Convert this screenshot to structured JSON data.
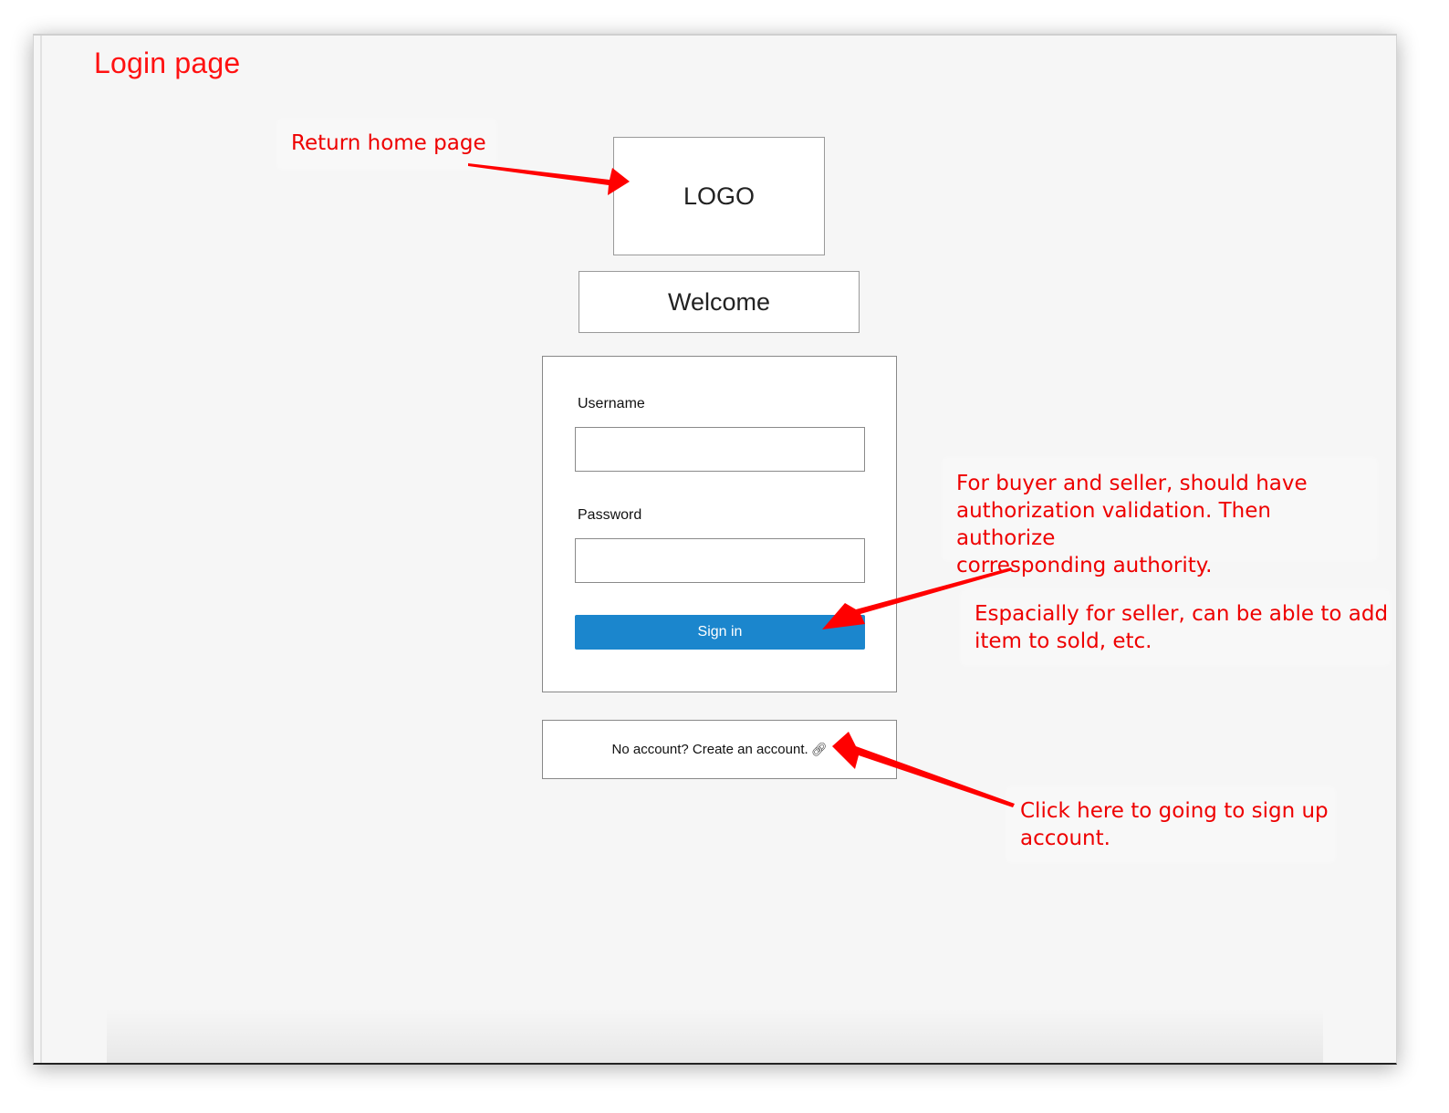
{
  "annotations": {
    "page_title": "Login page",
    "return_home": "Return home page",
    "authorization": "For buyer and seller, should have\nauthorization validation. Then authorize\ncorresponding authority.",
    "seller": "Espacially for seller, can be able to add\nitem to sold, etc.",
    "signup": "Click here to going to sign up\naccount."
  },
  "header": {
    "logo_text": "LOGO",
    "welcome_text": "Welcome"
  },
  "login_form": {
    "username_label": "Username",
    "username_value": "",
    "password_label": "Password",
    "password_value": "",
    "signin_label": "Sign in"
  },
  "signup": {
    "prompt": "No account? Create an account.",
    "icon": "link-icon"
  },
  "colors": {
    "annotation": "#ee0000",
    "signin_button": "#1b86cd",
    "page_background": "#f6f6f6"
  }
}
